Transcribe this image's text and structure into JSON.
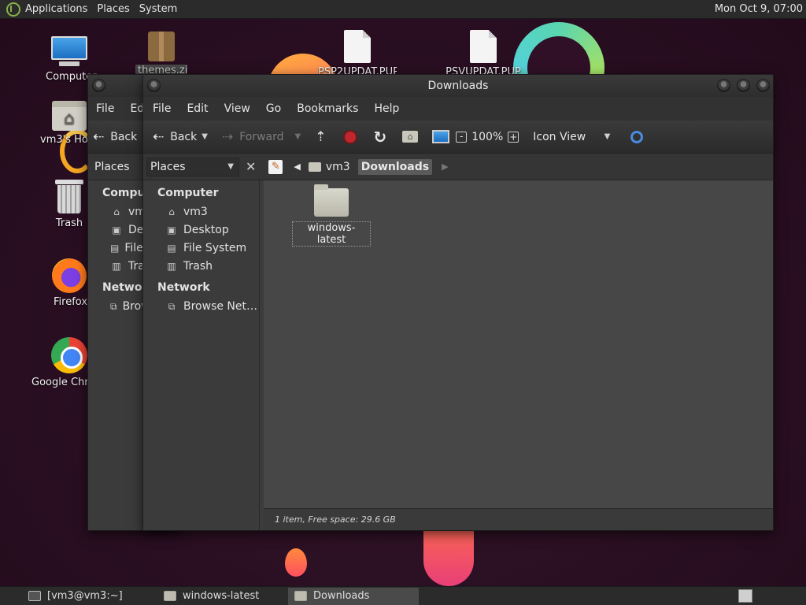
{
  "top_panel": {
    "menus": [
      "Applications",
      "Places",
      "System"
    ],
    "clock": "Mon Oct  9, 07:00"
  },
  "desktop": {
    "icons": [
      {
        "label": "Computer",
        "icon": "computer-icon"
      },
      {
        "label": "vm3's Home",
        "icon": "home-folder-icon"
      },
      {
        "label": "Trash",
        "icon": "trash-icon"
      },
      {
        "label": "Firefox",
        "icon": "firefox-icon"
      },
      {
        "label": "Google Chrome",
        "icon": "chrome-icon"
      },
      {
        "label": "themes.zip",
        "icon": "package-icon"
      },
      {
        "label": "PSP2UPDAT.PUP",
        "icon": "document-icon"
      },
      {
        "label": "PSVUPDAT.PUP",
        "icon": "document-icon"
      }
    ]
  },
  "back_window": {
    "menus": [
      "File",
      "Edit"
    ],
    "toolbar": {
      "back": "Back"
    },
    "places_label": "Places",
    "sidebar": {
      "computer_head": "Computer",
      "items": [
        "vm3",
        "Desktop",
        "File System",
        "Trash"
      ],
      "network_head": "Network",
      "network_items": [
        "Browse Network"
      ]
    }
  },
  "window": {
    "title": "Downloads",
    "menus": [
      "File",
      "Edit",
      "View",
      "Go",
      "Bookmarks",
      "Help"
    ],
    "toolbar": {
      "back": "Back",
      "forward": "Forward",
      "zoom": "100%",
      "view_mode": "Icon View"
    },
    "places_label": "Places",
    "breadcrumb": [
      "vm3",
      "Downloads"
    ],
    "sidebar": {
      "computer_head": "Computer",
      "items": [
        "vm3",
        "Desktop",
        "File System",
        "Trash"
      ],
      "network_head": "Network",
      "network_items": [
        "Browse Net…"
      ]
    },
    "files": [
      {
        "name": "windows-latest",
        "type": "folder"
      }
    ],
    "status": "1 item, Free space: 29.6 GB"
  },
  "taskbar": {
    "tasks": [
      {
        "label": "[vm3@vm3:~]",
        "icon": "terminal-icon",
        "active": false
      },
      {
        "label": "windows-latest",
        "icon": "folder-icon",
        "active": false
      },
      {
        "label": "Downloads",
        "icon": "folder-icon",
        "active": true
      }
    ]
  }
}
